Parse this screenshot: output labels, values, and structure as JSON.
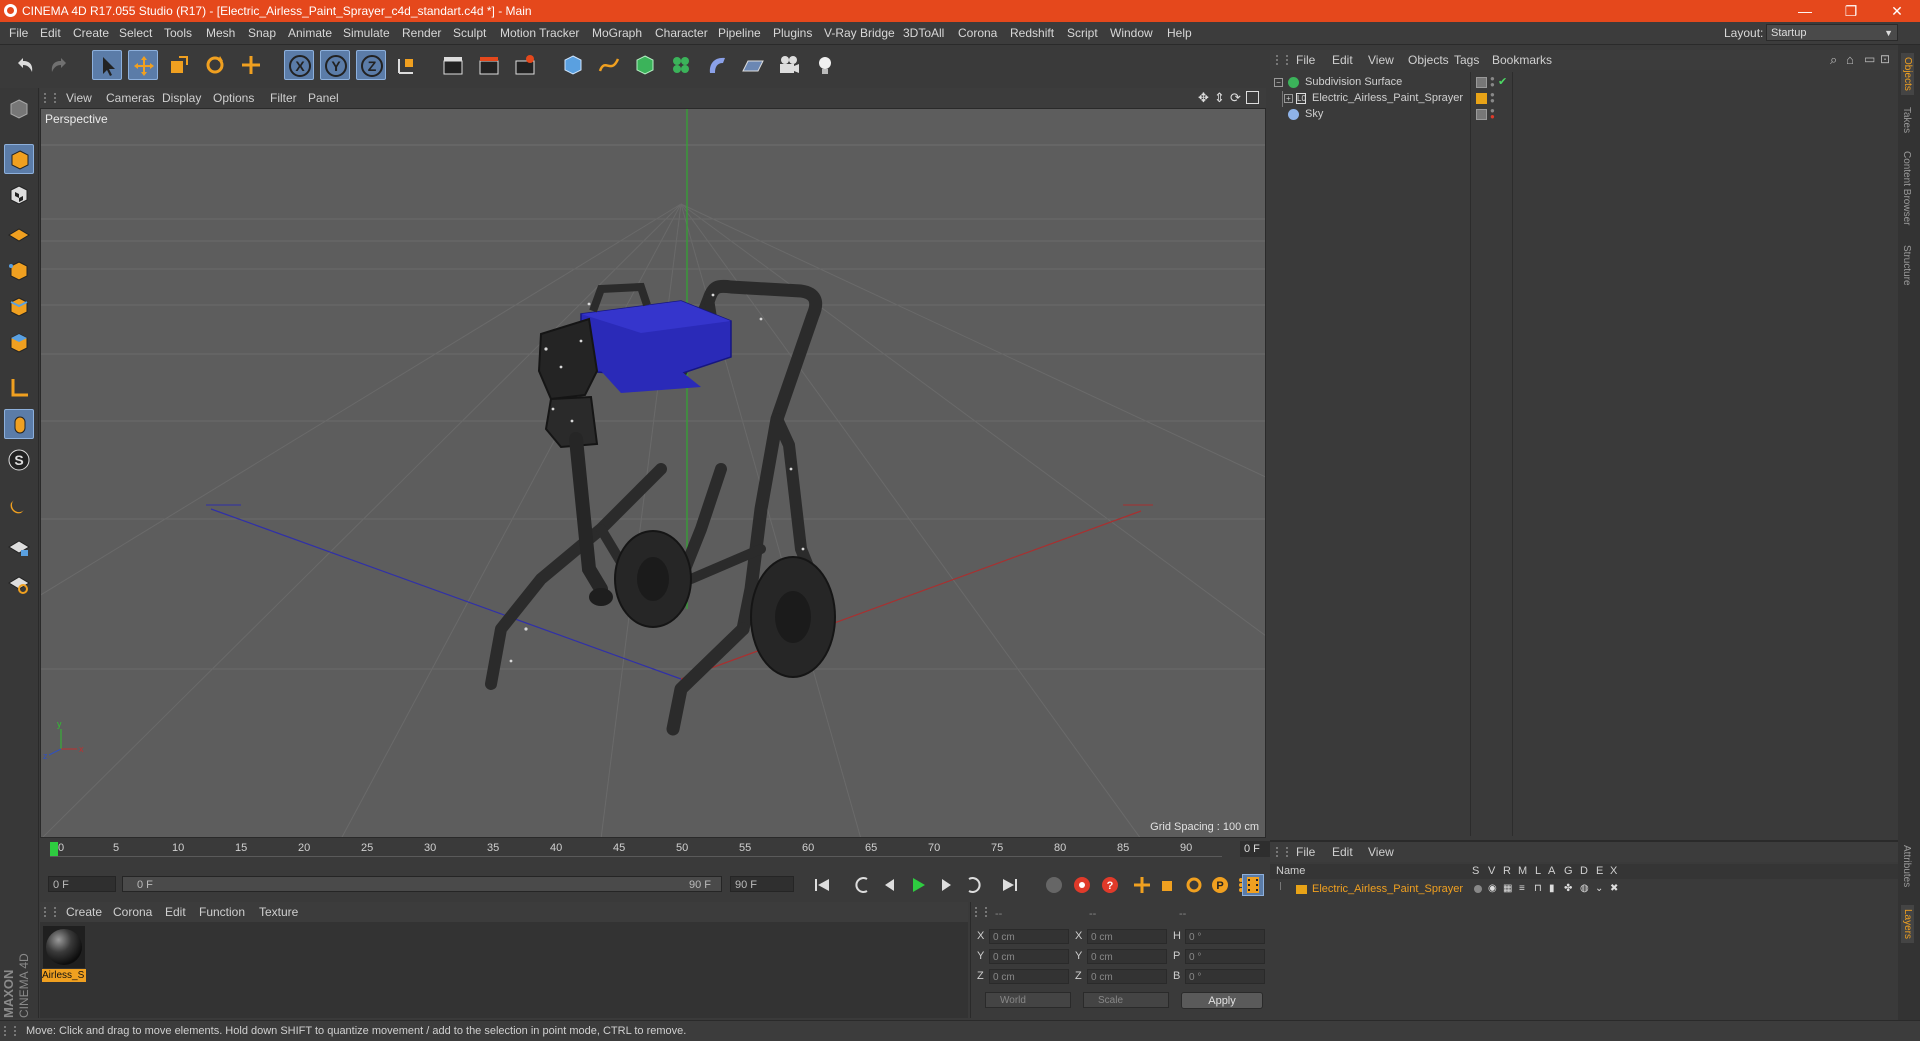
{
  "window": {
    "title": "CINEMA 4D R17.055 Studio (R17) - [Electric_Airless_Paint_Sprayer_c4d_standart.c4d *] - Main",
    "minimize": "—",
    "restore": "❐",
    "close": "✕"
  },
  "menu": {
    "items": [
      "File",
      "Edit",
      "Create",
      "Select",
      "Tools",
      "Mesh",
      "Snap",
      "Animate",
      "Simulate",
      "Render",
      "Sculpt",
      "Motion Tracker",
      "MoGraph",
      "Character",
      "Pipeline",
      "Plugins",
      "V-Ray Bridge",
      "3DToAll",
      "Corona",
      "Redshift",
      "Script",
      "Window",
      "Help"
    ],
    "layout_label": "Layout:",
    "layout_value": "Startup"
  },
  "viewport": {
    "menu": [
      "View",
      "Cameras",
      "Display",
      "Options",
      "Filter",
      "Panel"
    ],
    "camera_label": "Perspective",
    "grid_spacing": "Grid Spacing : 100 cm"
  },
  "timeline": {
    "ticks": [
      "0",
      "5",
      "10",
      "15",
      "20",
      "25",
      "30",
      "35",
      "40",
      "45",
      "50",
      "55",
      "60",
      "65",
      "70",
      "75",
      "80",
      "85",
      "90"
    ],
    "current_frame": "0 F",
    "start_field": "0 F",
    "range_start": "0 F",
    "range_end": "90 F",
    "end_field": "90 F"
  },
  "material_manager": {
    "menu": [
      "Create",
      "Corona",
      "Edit",
      "Function",
      "Texture"
    ],
    "materials": [
      {
        "label": "Airless_S"
      }
    ]
  },
  "coordinates": {
    "headers": [
      "--",
      "--",
      "--"
    ],
    "rows": [
      {
        "a_label": "X",
        "a_val": "0 cm",
        "b_label": "X",
        "b_val": "0 cm",
        "c_label": "H",
        "c_val": "0 °"
      },
      {
        "a_label": "Y",
        "a_val": "0 cm",
        "b_label": "Y",
        "b_val": "0 cm",
        "c_label": "P",
        "c_val": "0 °"
      },
      {
        "a_label": "Z",
        "a_val": "0 cm",
        "b_label": "Z",
        "b_val": "0 cm",
        "c_label": "B",
        "c_val": "0 °"
      }
    ],
    "space_select": "World",
    "mode_select": "Scale",
    "apply_label": "Apply"
  },
  "object_manager": {
    "menu": [
      "File",
      "Edit",
      "View",
      "Objects",
      "Tags",
      "Bookmarks"
    ],
    "objects": [
      {
        "name": "Subdivision Surface"
      },
      {
        "name": "Electric_Airless_Paint_Sprayer"
      },
      {
        "name": "Sky"
      }
    ]
  },
  "layer_manager": {
    "menu": [
      "File",
      "Edit",
      "View"
    ],
    "columns": [
      "Name",
      "S",
      "V",
      "R",
      "M",
      "L",
      "A",
      "G",
      "D",
      "E",
      "X"
    ],
    "layers": [
      {
        "name": "Electric_Airless_Paint_Sprayer",
        "color": "#e8a317"
      }
    ]
  },
  "right_tabs": [
    "Objects",
    "Takes",
    "Content Browser",
    "Structure",
    "Attributes",
    "Layers"
  ],
  "brand": {
    "maxon": "MAXON",
    "cinema": "CINEMA 4D"
  },
  "status": "Move: Click and drag to move elements. Hold down SHIFT to quantize movement / add to the selection in point mode, CTRL to remove.",
  "colors": {
    "accent": "#e5481c",
    "selection": "#5b7ca8",
    "layer_highlight": "#f0a020"
  }
}
